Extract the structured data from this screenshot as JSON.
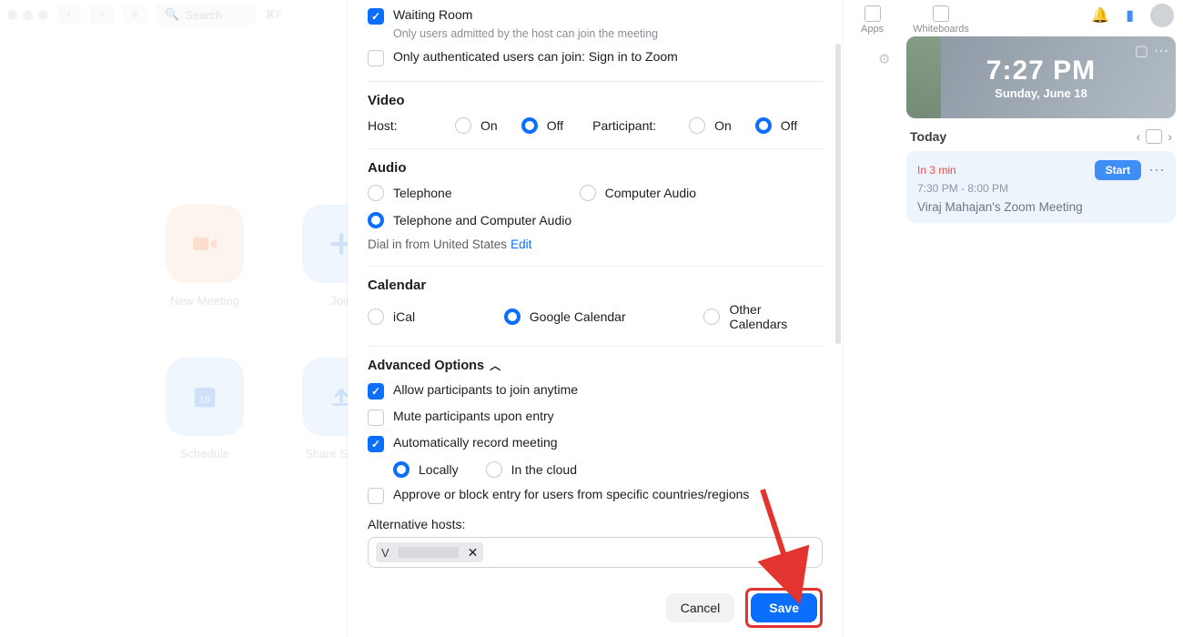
{
  "topbar": {
    "search_placeholder": "Search",
    "shortcut": "⌘F"
  },
  "nav": {
    "apps": "Apps",
    "whiteboards": "Whiteboards"
  },
  "tiles": {
    "new_meeting": "New Meeting",
    "join": "Join",
    "schedule": "Schedule",
    "share": "Share Screen"
  },
  "clock": {
    "time": "7:27 PM",
    "date": "Sunday, June 18"
  },
  "today": {
    "label": "Today"
  },
  "event": {
    "soon": "In 3 min",
    "start": "Start",
    "timespan": "7:30 PM - 8:00 PM",
    "title": "Viraj Mahajan's Zoom Meeting"
  },
  "modal": {
    "waiting_room": "Waiting Room",
    "waiting_room_note": "Only users admitted by the host can join the meeting",
    "auth_only": "Only authenticated users can join: Sign in to Zoom",
    "video_header": "Video",
    "host": "Host:",
    "participant": "Participant:",
    "on": "On",
    "off": "Off",
    "audio_header": "Audio",
    "telephone": "Telephone",
    "computer_audio": "Computer Audio",
    "tele_and_computer": "Telephone and Computer Audio",
    "dial_in": "Dial in from United States",
    "edit": "Edit",
    "calendar_header": "Calendar",
    "ical": "iCal",
    "gcal": "Google Calendar",
    "other_cal": "Other Calendars",
    "adv_header": "Advanced Options",
    "allow_join": "Allow participants to join anytime",
    "mute_entry": "Mute participants upon entry",
    "auto_record": "Automatically record meeting",
    "locally": "Locally",
    "in_cloud": "In the cloud",
    "approve_block": "Approve or block entry for users from specific countries/regions",
    "alt_hosts_label": "Alternative hosts:",
    "chip_text": "V",
    "cancel": "Cancel",
    "save": "Save"
  }
}
